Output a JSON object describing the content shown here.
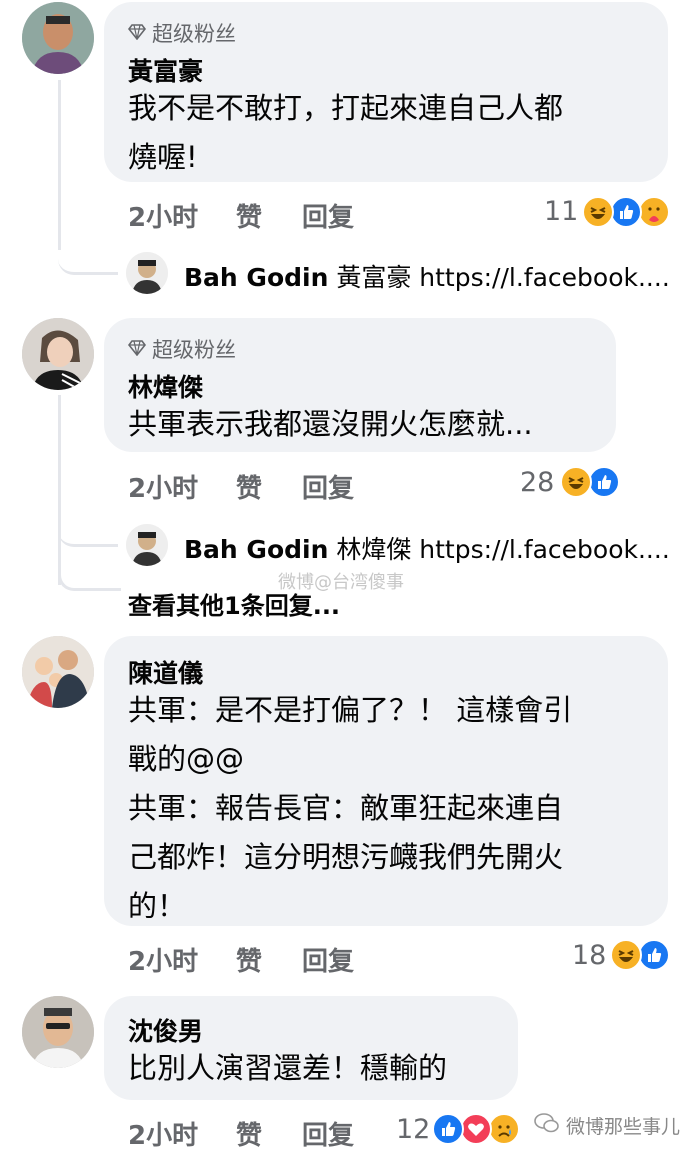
{
  "comments": [
    {
      "badge": "超级粉丝",
      "name": "黃富豪",
      "lines": [
        "我不是不敢打，打起來連自己人都",
        "燒喔!"
      ],
      "time": "2小时",
      "like": "赞",
      "reply": "回复",
      "reaction_count": "11",
      "reactions": [
        "haha",
        "like",
        "care"
      ],
      "reply_preview": {
        "author": "Bah Godin",
        "text": " 黃富豪 https://l.facebook...."
      }
    },
    {
      "badge": "超级粉丝",
      "name": "林煒傑",
      "lines": [
        "共軍表示我都還沒開火怎麼就..."
      ],
      "time": "2小时",
      "like": "赞",
      "reply": "回复",
      "reaction_count": "28",
      "reactions": [
        "haha",
        "like"
      ],
      "reply_preview": {
        "author": "Bah Godin",
        "text": " 林煒傑 https://l.facebook...."
      },
      "more_replies": "查看其他1条回复..."
    },
    {
      "name": "陳道儀",
      "lines": [
        "共軍：是不是打偏了？！ 這樣會引",
        "戰的@@",
        "共軍：報告長官：敵軍狂起來連自",
        "己都炸！這分明想污衊我們先開火",
        "的！"
      ],
      "time": "2小时",
      "like": "赞",
      "reply": "回复",
      "reaction_count": "18",
      "reactions": [
        "haha",
        "like"
      ]
    },
    {
      "name": "沈俊男",
      "lines": [
        "比別人演習還差！穩輸的"
      ],
      "time": "2小时",
      "like": "赞",
      "reply": "回复",
      "reaction_count": "12",
      "reactions": [
        "like",
        "love",
        "sad"
      ]
    }
  ],
  "watermarks": {
    "center": "微博@台湾傻事",
    "corner": "微博那些事儿"
  },
  "colors": {
    "bubble": "#f0f2f5",
    "secondary_text": "#65676b",
    "like_blue": "#1877f2",
    "haha_yellow": "#f7b125",
    "love_red": "#f33e58"
  },
  "icons": [
    "diamond-icon",
    "haha-reaction-icon",
    "like-reaction-icon",
    "care-reaction-icon",
    "love-reaction-icon",
    "sad-reaction-icon",
    "wechat-icon"
  ]
}
